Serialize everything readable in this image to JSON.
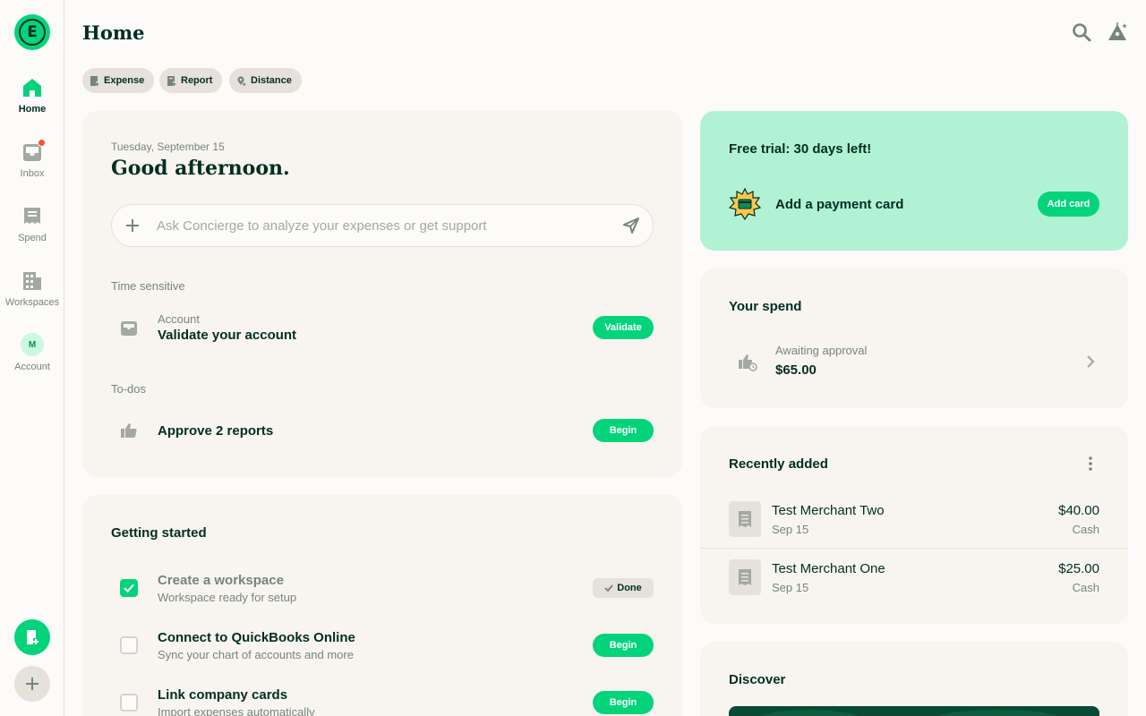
{
  "sidebar": {
    "logo_letter": "E",
    "items": [
      {
        "label": "Home",
        "icon": "home-icon"
      },
      {
        "label": "Inbox",
        "icon": "inbox-icon"
      },
      {
        "label": "Spend",
        "icon": "receipt-icon"
      },
      {
        "label": "Workspaces",
        "icon": "building-icon"
      },
      {
        "label": "Account",
        "icon": "avatar"
      }
    ],
    "avatar_initial": "M"
  },
  "header": {
    "title": "Home"
  },
  "quick_actions": [
    "Expense",
    "Report",
    "Distance"
  ],
  "greeting": {
    "date": "Tuesday, September 15",
    "title": "Good afternoon.",
    "concierge_placeholder": "Ask Concierge to analyze your expenses or get support"
  },
  "time_sensitive": {
    "heading": "Time sensitive",
    "item": {
      "category": "Account",
      "title": "Validate your account",
      "action": "Validate"
    }
  },
  "todos": {
    "heading": "To-dos",
    "item": {
      "title": "Approve 2 reports",
      "action": "Begin"
    }
  },
  "getting_started": {
    "heading": "Getting started",
    "items": [
      {
        "title": "Create a workspace",
        "subtitle": "Workspace ready for setup",
        "status": "Done",
        "checked": true
      },
      {
        "title": "Connect to QuickBooks Online",
        "subtitle": "Sync your chart of accounts and more",
        "status": "Begin",
        "checked": false
      },
      {
        "title": "Link company cards",
        "subtitle": "Import expenses automatically",
        "status": "Begin",
        "checked": false
      }
    ]
  },
  "trial": {
    "title": "Free trial: 30 days left!",
    "payment_label": "Add a payment card",
    "action": "Add card"
  },
  "your_spend": {
    "heading": "Your spend",
    "label": "Awaiting approval",
    "amount": "$65.00"
  },
  "recently_added": {
    "heading": "Recently added",
    "items": [
      {
        "merchant": "Test Merchant Two",
        "date": "Sep 15",
        "amount": "$40.00",
        "type": "Cash"
      },
      {
        "merchant": "Test Merchant One",
        "date": "Sep 15",
        "amount": "$25.00",
        "type": "Cash"
      }
    ]
  },
  "discover": {
    "heading": "Discover"
  },
  "colors": {
    "accent": "#03d47c",
    "text": "#002e22",
    "muted": "#76847e",
    "card": "#f8f5f0",
    "trial_bg": "#b2f2d4",
    "notification": "#f25730"
  }
}
